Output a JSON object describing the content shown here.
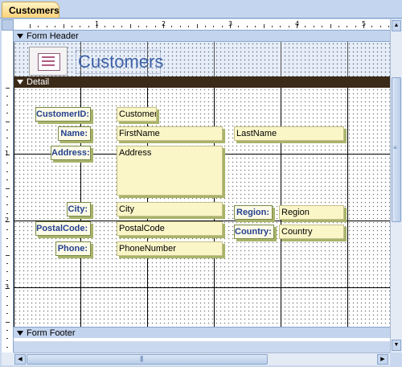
{
  "window": {
    "tab_title": "Customers"
  },
  "ruler": {
    "h_numbers": [
      "1",
      "2",
      "3",
      "4",
      "5"
    ],
    "v_numbers": [
      "1",
      "2",
      "3"
    ]
  },
  "sections": {
    "header": "Form Header",
    "detail": "Detail",
    "footer": "Form Footer"
  },
  "form_header": {
    "title": "Customers",
    "logo_icon": "form-logo-icon"
  },
  "labels": {
    "customer_id": "CustomerID:",
    "name": "Name:",
    "address": "Address:",
    "city": "City:",
    "region": "Region:",
    "postal_code": "PostalCode:",
    "country": "Country:",
    "phone": "Phone:"
  },
  "fields": {
    "customer_id": "CustomerID",
    "first_name": "FirstName",
    "last_name": "LastName",
    "address": "Address",
    "city": "City",
    "region": "Region",
    "postal_code": "PostalCode",
    "country": "Country",
    "phone": "PhoneNumber"
  },
  "colors": {
    "detail_bar": "#3b2a18",
    "label_text": "#24408f",
    "field_bg": "#fbf6c8",
    "title_text": "#3e61a8"
  }
}
